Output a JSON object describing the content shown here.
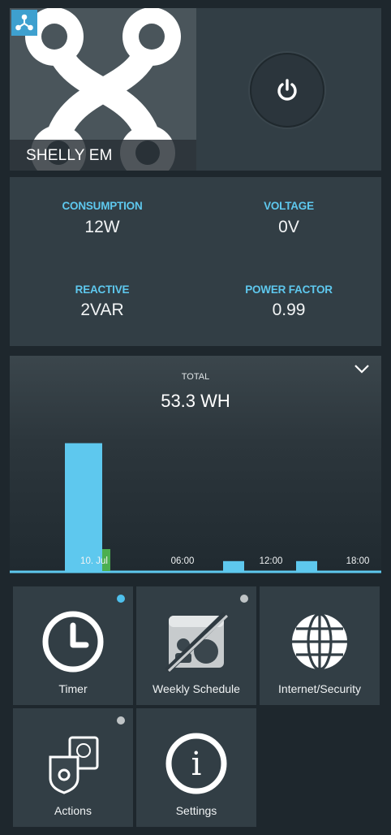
{
  "device": {
    "name": "SHELLY EM",
    "logo_icon": "shelly-logo-icon",
    "corner_icon": "network-icon",
    "power_icon": "power-icon"
  },
  "metrics": {
    "consumption": {
      "label": "CONSUMPTION",
      "value": "12W"
    },
    "voltage": {
      "label": "VOLTAGE",
      "value": "0V"
    },
    "reactive": {
      "label": "REACTIVE",
      "value": "2VAR"
    },
    "power_factor": {
      "label": "POWER FACTOR",
      "value": "0.99"
    }
  },
  "chart": {
    "total_label": "TOTAL",
    "total_value": "53.3 WH",
    "toggle_icon": "chevron-down-icon",
    "accent": "#5ec8ee"
  },
  "chart_data": {
    "type": "bar",
    "x_ticks": [
      "10. Jul",
      "06:00",
      "12:00",
      "18:00"
    ],
    "bars": [
      {
        "time": "00:00",
        "value": 36
      },
      {
        "time": "13:00",
        "value": 3
      },
      {
        "time": "19:00",
        "value": 3
      }
    ],
    "highlighted_tick": "10. Jul",
    "highlight_color": "#4caf50",
    "bar_color": "#5ec8ee",
    "ylim": [
      0,
      40
    ]
  },
  "tiles": [
    {
      "label": "Timer",
      "icon": "clock-icon",
      "dot": "#4ec0ec"
    },
    {
      "label": "Weekly Schedule",
      "icon": "schedule-disabled-icon",
      "dot": "#bfc4c6"
    },
    {
      "label": "Internet/Security",
      "icon": "globe-icon",
      "dot": ""
    },
    {
      "label": "Actions",
      "icon": "actions-icon",
      "dot": "#bfc4c6"
    },
    {
      "label": "Settings",
      "icon": "info-icon",
      "dot": ""
    }
  ]
}
